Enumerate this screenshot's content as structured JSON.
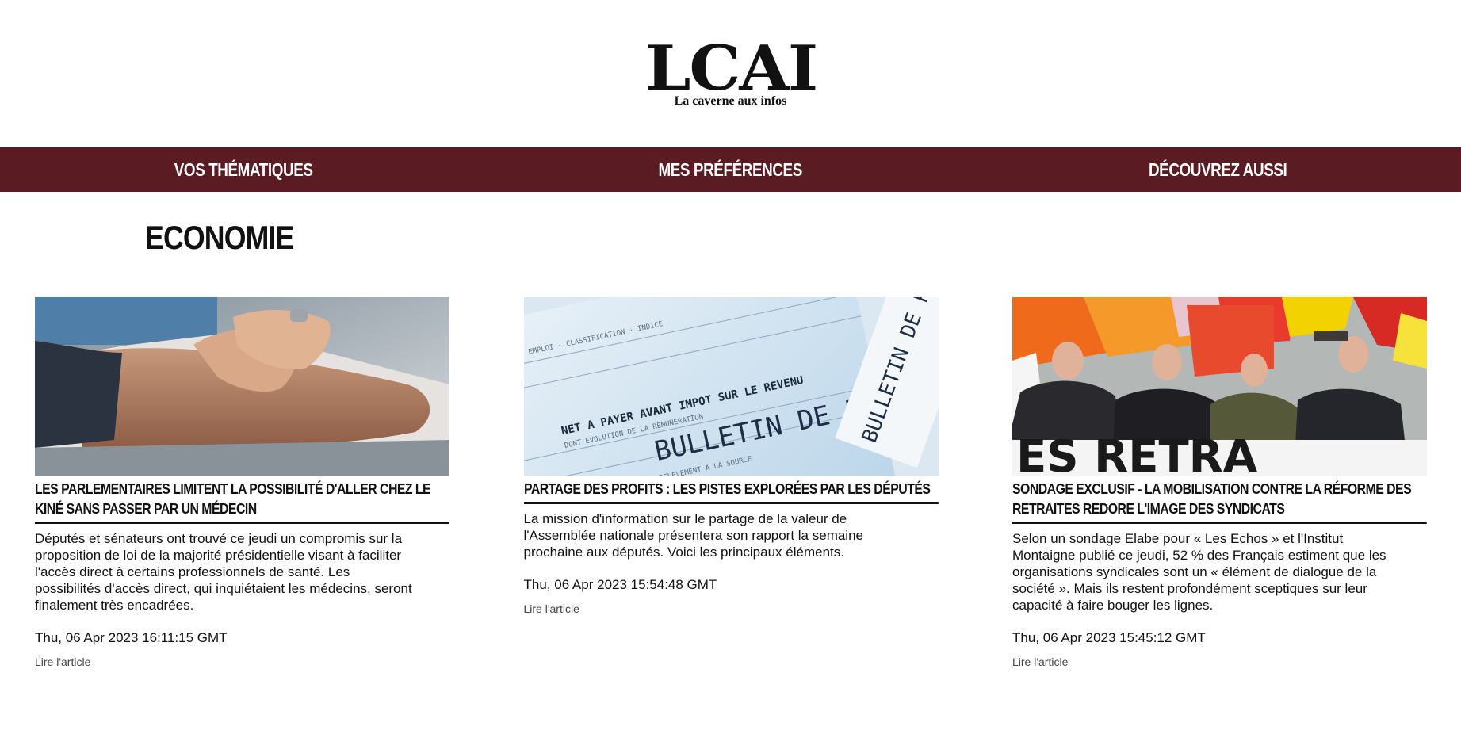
{
  "brand": {
    "logo_text": "LCAI",
    "tagline": "La caverne aux infos",
    "nav_color": "#5a1c22"
  },
  "nav": {
    "items": [
      {
        "label": "VOS THÉMATIQUES"
      },
      {
        "label": "MES PRÉFÉRENCES"
      },
      {
        "label": "DÉCOUVREZ AUSSI"
      }
    ]
  },
  "section": {
    "title": "ECONOMIE"
  },
  "articles": [
    {
      "title": "LES PARLEMENTAIRES LIMITENT LA POSSIBILITÉ D'ALLER CHEZ LE KINÉ SANS PASSER PAR UN MÉDECIN",
      "summary": "Députés et sénateurs ont trouvé ce jeudi un compromis sur la proposition de loi de la majorité présidentielle visant à faciliter l'accès direct à certains professionnels de santé. Les possibilités d'accès direct, qui inquiétaient les médecins, seront finalement très encadrées.",
      "date": "Thu, 06 Apr 2023 16:11:15 GMT",
      "link_label": "Lire l'article",
      "image_icon": "physiotherapy-photo"
    },
    {
      "title": "PARTAGE DES PROFITS : LES PISTES EXPLORÉES PAR LES DÉPUTÉS",
      "summary": "La mission d'information sur le partage de la valeur de l'Assemblée nationale présentera son rapport la semaine prochaine aux députés. Voici les principaux éléments.",
      "date": "Thu, 06 Apr 2023 15:54:48 GMT",
      "link_label": "Lire l'article",
      "image_icon": "payslip-photo",
      "image_texts": [
        "BULLETIN DE PAIE",
        "BULLETIN DE PA",
        "NET A PAYER AVANT IMPOT SUR LE REVENU"
      ]
    },
    {
      "title": "SONDAGE EXCLUSIF - LA MOBILISATION CONTRE LA RÉFORME DES RETRAITES REDORE L'IMAGE DES SYNDICATS",
      "summary": "Selon un sondage Elabe pour « Les Echos » et l'Institut Montaigne publié ce jeudi, 52 % des Français estiment que les organisations syndicales sont un « élément de dialogue de la société ». Mais ils restent profondément sceptiques sur leur capacité à faire bouger les lignes.",
      "date": "Thu, 06 Apr 2023 15:45:12 GMT",
      "link_label": "Lire l'article",
      "image_icon": "protest-march-photo",
      "image_texts": [
        "ES RETRA"
      ]
    }
  ]
}
